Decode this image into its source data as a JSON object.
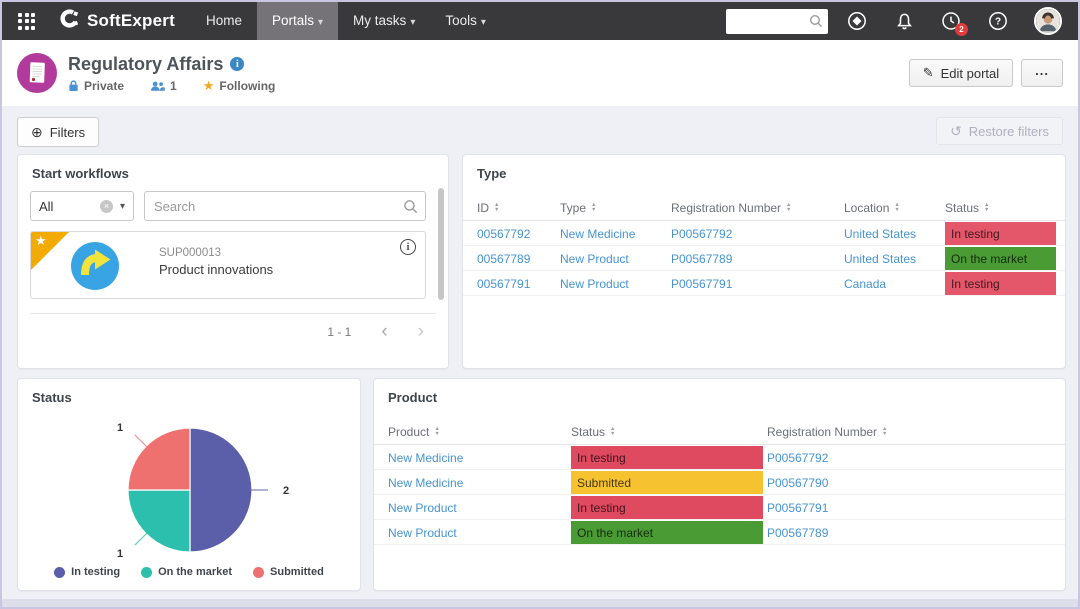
{
  "navbar": {
    "brand": "SoftExpert",
    "items": [
      {
        "label": "Home",
        "active": false,
        "caret": false
      },
      {
        "label": "Portals",
        "active": true,
        "caret": true
      },
      {
        "label": "My tasks",
        "active": false,
        "caret": true
      },
      {
        "label": "Tools",
        "active": false,
        "caret": true
      }
    ],
    "search_value": "",
    "help_badge": "2"
  },
  "header": {
    "title": "Regulatory Affairs",
    "privacy_label": "Private",
    "members_count": "1",
    "following_label": "Following",
    "edit_portal_label": "Edit portal",
    "more_label": "..."
  },
  "filters": {
    "filters_label": "Filters",
    "restore_label": "Restore filters"
  },
  "workflows": {
    "title": "Start workflows",
    "dropdown_value": "All",
    "search_placeholder": "Search",
    "card": {
      "id": "SUP000013",
      "name": "Product innovations"
    },
    "pagination": "1 - 1"
  },
  "type_panel": {
    "title": "Type",
    "columns": [
      "ID",
      "Type",
      "Registration Number",
      "Location",
      "Status"
    ],
    "rows": [
      {
        "id": "00567792",
        "type": "New Medicine",
        "reg": "P00567792",
        "location": "United States",
        "status": "In testing",
        "status_key": "in-testing"
      },
      {
        "id": "00567789",
        "type": "New Product",
        "reg": "P00567789",
        "location": "United States",
        "status": "On the market",
        "status_key": "on-market"
      },
      {
        "id": "00567791",
        "type": "New Product",
        "reg": "P00567791",
        "location": "Canada",
        "status": "In testing",
        "status_key": "in-testing"
      }
    ]
  },
  "status_panel": {
    "title": "Status"
  },
  "chart_data": {
    "type": "pie",
    "title": "Status",
    "labels": [
      "In testing",
      "On the market",
      "Submitted"
    ],
    "values": [
      2,
      1,
      1
    ],
    "colors": [
      "#5b5fa9",
      "#2dbfae",
      "#ee7170"
    ],
    "legend_position": "bottom",
    "data_labels": [
      "2",
      "1",
      "1"
    ]
  },
  "product_panel": {
    "title": "Product",
    "columns": [
      "Product",
      "Status",
      "Registration Number"
    ],
    "rows": [
      {
        "product": "New Medicine",
        "status": "In testing",
        "status_key": "in-testing",
        "reg": "P00567792"
      },
      {
        "product": "New Medicine",
        "status": "Submitted",
        "status_key": "submitted",
        "reg": "P00567790"
      },
      {
        "product": "New Product",
        "status": "In testing",
        "status_key": "in-testing",
        "reg": "P00567791"
      },
      {
        "product": "New Product",
        "status": "On the market",
        "status_key": "on-market",
        "reg": "P00567789"
      }
    ]
  },
  "colors": {
    "status_red": "#e4576b",
    "status_green": "#4a9b33",
    "status_yellow": "#f6c22f",
    "link_blue": "#4793d2",
    "portal_accent": "#b13a9c",
    "navbar_bg": "#39383a",
    "ribbon_yellow": "#f2ab00",
    "workflow_circle_blue": "#38a4e4"
  },
  "icons": {
    "caret": "▾",
    "sort_up": "▲",
    "sort_down": "▼",
    "chevron_left": "‹",
    "chevron_right": "›",
    "plus_circle": "⊕",
    "restore": "↺",
    "star": "★",
    "pencil": "✎",
    "info_letter": "i",
    "clear": "×"
  }
}
